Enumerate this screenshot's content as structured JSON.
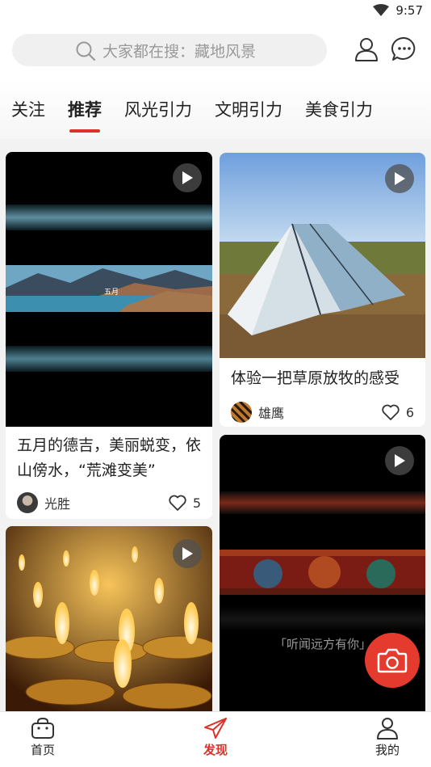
{
  "status": {
    "time": "9:57"
  },
  "search": {
    "placeholder": "大家都在搜：藏地风景"
  },
  "tabs": [
    {
      "label": "关注",
      "active": false
    },
    {
      "label": "推荐",
      "active": true
    },
    {
      "label": "风光引力",
      "active": false
    },
    {
      "label": "文明引力",
      "active": false
    },
    {
      "label": "美食引力",
      "active": false
    }
  ],
  "cards": [
    {
      "title": "五月的德吉，美丽蜕变，依山傍水，“荒滩变美”",
      "author": "光胜",
      "likes": "5",
      "media_caption": "五月",
      "is_video": true
    },
    {
      "title": "体验一把草原放牧的感受",
      "author": "雄鹰",
      "likes": "6",
      "is_video": true
    },
    {
      "title": "",
      "author": "",
      "likes": "",
      "is_video": true
    },
    {
      "title": "",
      "author": "",
      "likes": "",
      "media_caption": "「听闻远方有你」",
      "is_video": true
    }
  ],
  "nav": [
    {
      "label": "首页",
      "icon": "bag-icon",
      "active": false
    },
    {
      "label": "发现",
      "icon": "paper-plane-icon",
      "active": true
    },
    {
      "label": "我的",
      "icon": "user-icon",
      "active": false
    }
  ],
  "colors": {
    "accent": "#d9332b",
    "fab": "#e53a2e"
  }
}
